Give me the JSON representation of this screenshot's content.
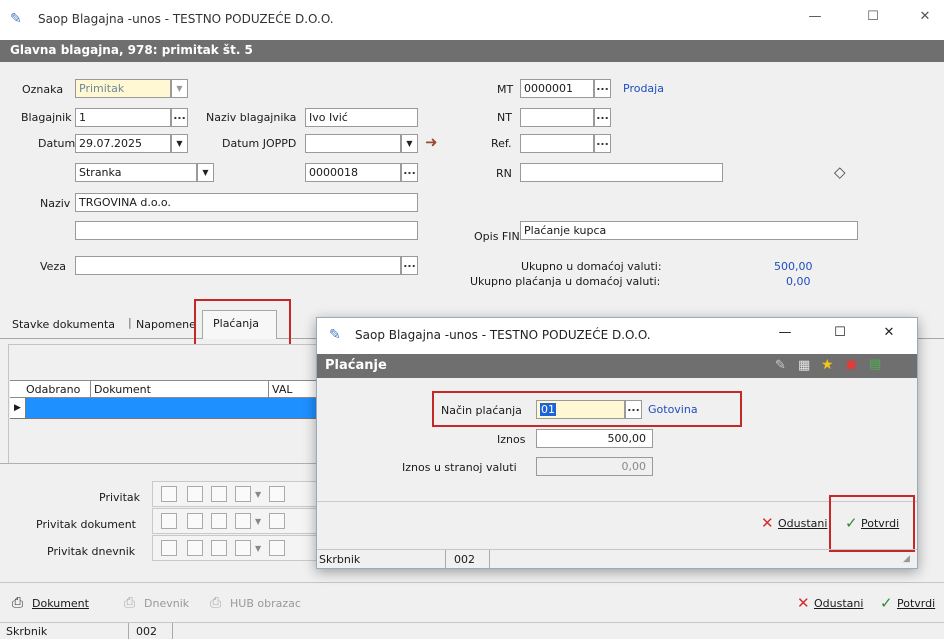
{
  "main": {
    "window_title": "Saop Blagajna -unos - TESTNO PODUZEĆE D.O.O.",
    "doc_header": "Glavna blagajna, 978: primitak št. 5",
    "fields": {
      "oznaka_label": "Oznaka",
      "oznaka_value": "Primitak",
      "blagajnik_label": "Blagajnik",
      "blagajnik_value": "1",
      "naziv_blagajnika_label": "Naziv blagajnika",
      "naziv_blagajnika_value": "Ivo Ivić",
      "datum_label": "Datum",
      "datum_value": "29.07.2025",
      "datum_joppd_label": "Datum JOPPD",
      "datum_joppd_value": "",
      "partner_type_value": "Stranka",
      "partner_code_value": "0000018",
      "naziv_label": "Naziv",
      "naziv_value": "TRGOVINA d.o.o.",
      "naziv2_value": "",
      "veza_label": "Veza",
      "veza_value": "",
      "mt_label": "MT",
      "mt_value": "0000001",
      "mt_link": "Prodaja",
      "nt_label": "NT",
      "nt_value": "",
      "ref_label": "Ref.",
      "ref_value": "",
      "rn_label": "RN",
      "rn_value": "",
      "opis_label": "Opis FIN",
      "opis_value": "Plaćanje kupca"
    },
    "totals": {
      "domestic_label": "Ukupno u domaćoj valuti:",
      "domestic_value": "500,00",
      "paid_label": "Ukupno plaćanja u domaćoj valuti:",
      "paid_value": "0,00"
    },
    "tabs": [
      "Stavke dokumenta",
      "Napomene",
      "Plaćanja"
    ],
    "grid": {
      "columns": [
        "Odabrano",
        "Dokument",
        "VAL"
      ]
    },
    "attachments": {
      "privitak": "Privitak",
      "privitak_dokument": "Privitak dokument",
      "privitak_dnevnik": "Privitak dnevnik"
    },
    "bottom_buttons": {
      "dokument": "Dokument",
      "dnevnik": "Dnevnik",
      "hub": "HUB obrazac",
      "odustani": "Odustani",
      "potvrdi": "Potvrdi"
    },
    "status": {
      "user": "Skrbnik",
      "code": "002"
    }
  },
  "dialog": {
    "window_title": "Saop Blagajna -unos - TESTNO PODUZEĆE D.O.O.",
    "header": "Plaćanje",
    "nacin_label": "Način plaćanja",
    "nacin_value": "01",
    "nacin_link": "Gotovina",
    "iznos_label": "Iznos",
    "iznos_value": "500,00",
    "iznos_strana_label": "Iznos u stranoj valuti",
    "iznos_strana_value": "0,00",
    "odustani": "Odustani",
    "potvrdi": "Potvrdi",
    "status_user": "Skrbnik",
    "status_code": "002"
  },
  "colors": {
    "header_bar": "#6f6f6f",
    "selection_blue": "#1e90ff",
    "link_blue": "#1f4ebd",
    "annotation_red": "#c62828",
    "confirm_green": "#2e8b2e",
    "cancel_red": "#d32f2f"
  }
}
